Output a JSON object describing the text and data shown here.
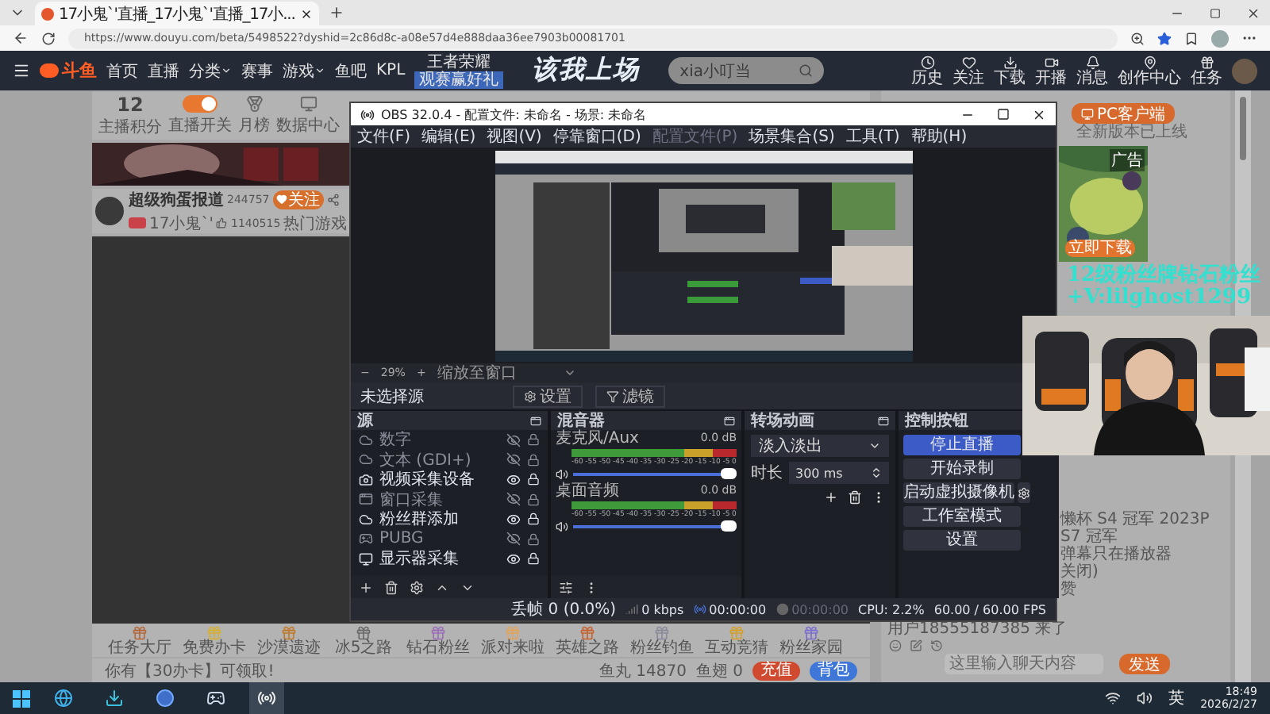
{
  "browser": {
    "tab": {
      "title": "17小鬼`'直播_17小鬼`'直播_17小...",
      "selected": true
    },
    "url": "https://www.douyu.com/beta/5498522?dyshid=2c86d8c-a08e57d4e888daa36ee7903b00081701"
  },
  "nav": {
    "logo": "斗鱼",
    "items": [
      {
        "label": "首页",
        "menu": false
      },
      {
        "label": "直播",
        "menu": false
      },
      {
        "label": "分类",
        "menu": true
      },
      {
        "label": "赛事",
        "menu": false
      },
      {
        "label": "游戏",
        "menu": true
      },
      {
        "label": "鱼吧",
        "menu": false
      },
      {
        "label": "KPL",
        "menu": false
      }
    ],
    "promo": [
      "王者荣耀",
      "观赛赢好礼"
    ],
    "slogan": "该我上场",
    "search": {
      "placeholder": "xia小叮当"
    },
    "actions": [
      {
        "label": "历史",
        "kind": "clock"
      },
      {
        "label": "关注",
        "kind": "heart"
      },
      {
        "label": "下载",
        "kind": "download"
      },
      {
        "label": "开播",
        "kind": "video"
      },
      {
        "label": "消息",
        "kind": "bell"
      },
      {
        "label": "创作中心",
        "kind": "pin"
      },
      {
        "label": "任务",
        "kind": "gift"
      }
    ]
  },
  "stats": [
    {
      "kind": "score",
      "value": "12",
      "label": "主播积分"
    },
    {
      "kind": "toggle",
      "on": true,
      "label": "直播开关"
    },
    {
      "kind": "medal",
      "label": "月榜"
    },
    {
      "kind": "monitor",
      "label": "数据中心"
    }
  ],
  "streamer": {
    "name": "超级狗蛋报道",
    "room": "244757",
    "follow": "关注",
    "category": "17小鬼`'",
    "likes": "1140515",
    "tag": "热门游戏"
  },
  "gifts": [
    "任务大厅",
    "免费办卡",
    "沙漠遗迹",
    "冰5之路",
    "钻石粉丝",
    "派对来啦",
    "英雄之路",
    "粉丝钓鱼",
    "互动竞猜",
    "粉丝家园"
  ],
  "wallet": {
    "notice": "你有【30办卡】可领取!",
    "fish_balls": "鱼丸 14870",
    "fins": "鱼翅 0",
    "recharge": "充值",
    "bag": "背包"
  },
  "sidebar": {
    "client_button": "PC客户端",
    "client_note": "全新版本已上线",
    "ad_tag": "广告",
    "ad_button": "立即下载",
    "overlay": [
      "12级粉丝牌钻石粉丝",
      "+V:lilghost1299"
    ],
    "chat": [
      "懒杯 S4 冠军 2023P",
      "S7 冠军",
      "弹幕只在播放器",
      "关闭)",
      "赞",
      "用户18555187385 来了"
    ],
    "chat_input": {
      "placeholder": "这里输入聊天内容"
    },
    "send": "发送"
  },
  "obs": {
    "title": "OBS 32.0.4 - 配置文件: 未命名 - 场景: 未命名",
    "menu": [
      {
        "label": "文件(F)",
        "disabled": false
      },
      {
        "label": "编辑(E)",
        "disabled": false
      },
      {
        "label": "视图(V)",
        "disabled": false
      },
      {
        "label": "停靠窗口(D)",
        "disabled": false
      },
      {
        "label": "配置文件(P)",
        "disabled": true
      },
      {
        "label": "场景集合(S)",
        "disabled": false
      },
      {
        "label": "工具(T)",
        "disabled": false
      },
      {
        "label": "帮助(H)",
        "disabled": false
      }
    ],
    "zoom": {
      "minus": "−",
      "value": "29%",
      "plus": "+",
      "mode": "缩放至窗口"
    },
    "toolbar": {
      "label": "未选择源",
      "buttons": [
        "设置",
        "滤镜"
      ]
    },
    "docks": [
      "源",
      "混音器",
      "转场动画",
      "控制按钮"
    ],
    "sources": [
      {
        "name": "数字",
        "kind": "browser",
        "visible": false
      },
      {
        "name": "文本 (GDI+)",
        "kind": "browser",
        "visible": false
      },
      {
        "name": "视频采集设备",
        "kind": "camera",
        "visible": true
      },
      {
        "name": "窗口采集",
        "kind": "window",
        "visible": false
      },
      {
        "name": "粉丝群添加",
        "kind": "browser",
        "visible": true
      },
      {
        "name": "PUBG",
        "kind": "game",
        "visible": false
      },
      {
        "name": "显示器采集",
        "kind": "display",
        "visible": true
      }
    ],
    "mixer": [
      {
        "name": "麦克风/Aux",
        "reading": "0.0 dB",
        "level": 1,
        "ticks": [
          "-60",
          "-55",
          "-50",
          "-45",
          "-40",
          "-35",
          "-30",
          "-25",
          "-20",
          "-15",
          "-10",
          "-5",
          "0"
        ]
      },
      {
        "name": "桌面音频",
        "reading": "0.0 dB",
        "level": 1,
        "ticks": [
          "-60",
          "-55",
          "-50",
          "-45",
          "-40",
          "-35",
          "-30",
          "-25",
          "-20",
          "-15",
          "-10",
          "-5",
          "0"
        ]
      }
    ],
    "transition": {
      "value": "淡入淡出",
      "duration_label": "时长",
      "duration": "300 ms"
    },
    "controls": [
      {
        "label": "停止直播",
        "active": true,
        "kind": "plain"
      },
      {
        "label": "开始录制",
        "active": false,
        "kind": "plain"
      },
      {
        "label": "启动虚拟摄像机",
        "active": false,
        "kind": "split"
      },
      {
        "label": "工作室模式",
        "active": false,
        "kind": "plain"
      },
      {
        "label": "设置",
        "active": false,
        "kind": "plain"
      }
    ],
    "status": [
      {
        "kind": "frames",
        "text": "丢帧 0 (0.0%)"
      },
      {
        "kind": "bitrate",
        "text": "0 kbps"
      },
      {
        "kind": "stream",
        "text": "00:00:00"
      },
      {
        "kind": "record",
        "text": "00:00:00"
      },
      {
        "kind": "cpu",
        "text": "CPU: 2.2%"
      },
      {
        "kind": "fps",
        "text": "60.00 / 60.00 FPS"
      }
    ]
  },
  "taskbar": {
    "ime": "英",
    "time": "18:49",
    "date": "2026/2/27"
  }
}
